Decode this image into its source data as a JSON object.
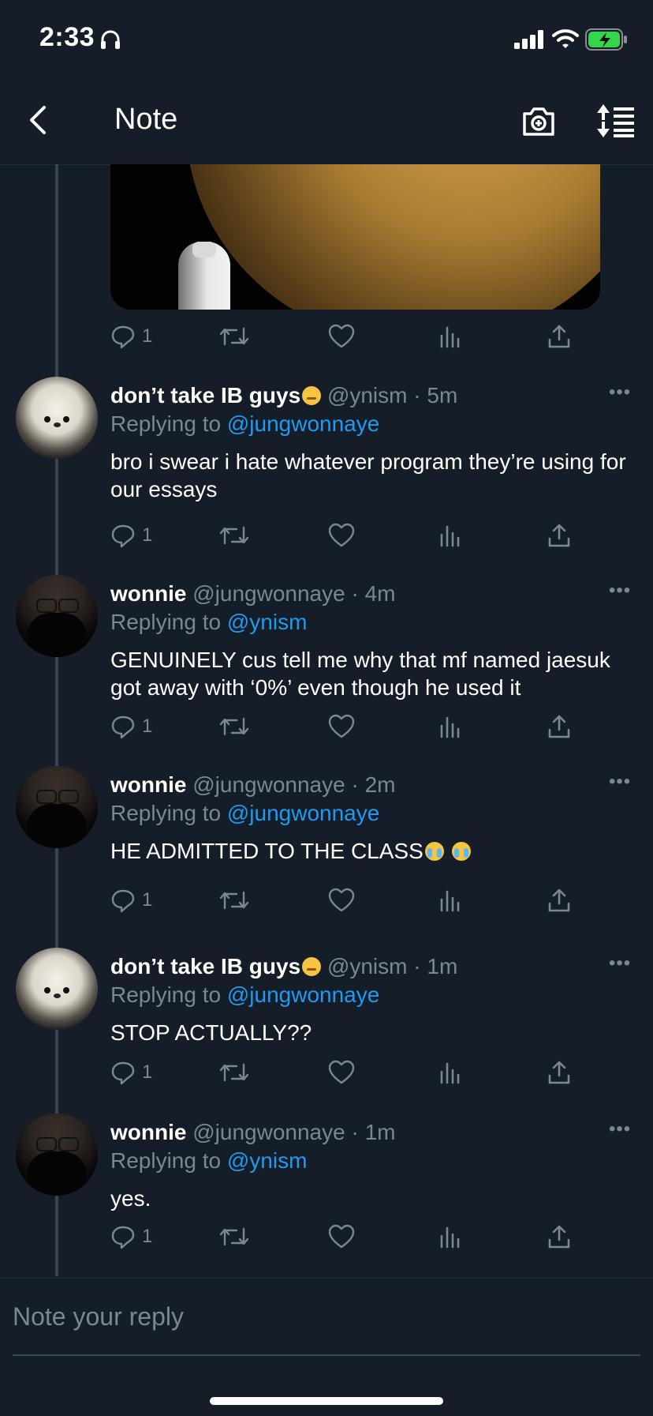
{
  "status_bar": {
    "time": "2:33",
    "icons": [
      "headphones-icon",
      "signal-icon",
      "wifi-icon",
      "battery-charging-icon"
    ]
  },
  "header": {
    "title": "Note",
    "back_icon": "chevron-left-icon",
    "camera_icon": "camera-icon",
    "sort_icon": "sort-icon"
  },
  "top_tweet_actions": {
    "reply_count": "1"
  },
  "tweets": [
    {
      "name": "don’t take IB guys",
      "handle": "@ynism",
      "time": "· 5m",
      "replying_label": "Replying to ",
      "replying_to": "@jungwonnaye",
      "text": "bro i swear i hate whatever program they’re using for our essays",
      "reply_count": "1"
    },
    {
      "name": "wonnie",
      "handle": "@jungwonnaye",
      "time": "· 4m",
      "replying_label": "Replying to ",
      "replying_to": "@ynism",
      "text": "GENUINELY cus tell me why that mf named jaesuk got away with ‘0%’ even though he used it",
      "reply_count": "1"
    },
    {
      "name": "wonnie",
      "handle": "@jungwonnaye",
      "time": "· 2m",
      "replying_label": "Replying to ",
      "replying_to": "@jungwonnaye",
      "text": "HE ADMITTED TO THE CLASS",
      "reply_count": "1"
    },
    {
      "name": "don’t take IB guys",
      "handle": "@ynism",
      "time": "· 1m",
      "replying_label": "Replying to ",
      "replying_to": "@jungwonnaye",
      "text": "STOP ACTUALLY??",
      "reply_count": "1"
    },
    {
      "name": "wonnie",
      "handle": "@jungwonnaye",
      "time": "· 1m",
      "replying_label": "Replying to ",
      "replying_to": "@ynism",
      "text": "yes.",
      "reply_count": "1"
    }
  ],
  "reply_box": {
    "placeholder": "Note your reply"
  },
  "colors": {
    "background": "#151d28",
    "accent": "#1d9bf0",
    "muted": "#7b8794"
  }
}
